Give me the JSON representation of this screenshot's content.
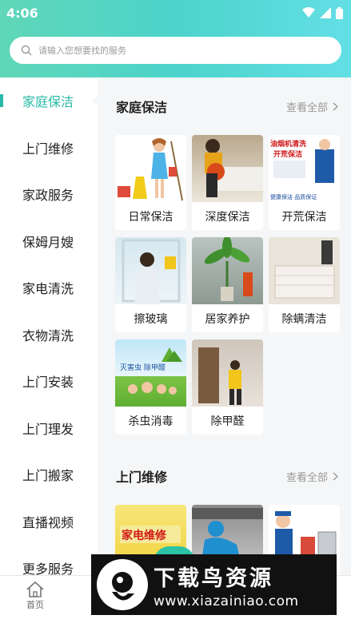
{
  "status_bar": {
    "time": "4:06"
  },
  "search": {
    "placeholder": "请输入您想要找的服务"
  },
  "sidebar": {
    "items": [
      {
        "label": "家庭保洁",
        "active": true
      },
      {
        "label": "上门维修"
      },
      {
        "label": "家政服务"
      },
      {
        "label": "保姆月嫂"
      },
      {
        "label": "家电清洗"
      },
      {
        "label": "衣物清洗"
      },
      {
        "label": "上门安装"
      },
      {
        "label": "上门理发"
      },
      {
        "label": "上门搬家"
      },
      {
        "label": "直播视频"
      },
      {
        "label": "更多服务"
      }
    ]
  },
  "sections": [
    {
      "title": "家庭保洁",
      "view_all": "查看全部",
      "items": [
        {
          "label": "日常保洁"
        },
        {
          "label": "深度保洁"
        },
        {
          "label": "开荒保洁",
          "photo_text": "油烟机清洗\n开荒保洁"
        },
        {
          "label": "擦玻璃"
        },
        {
          "label": "居家养护"
        },
        {
          "label": "除螨清洁"
        },
        {
          "label": "杀虫消毒",
          "photo_text": "灭害虫  除甲醛"
        },
        {
          "label": "除甲醛"
        }
      ]
    },
    {
      "title": "上门维修",
      "view_all": "查看全部",
      "items": [
        {
          "label": "",
          "photo_text": "家电维修"
        },
        {
          "label": ""
        },
        {
          "label": ""
        }
      ]
    }
  ],
  "tabbar": {
    "home_label": "首页"
  },
  "banner": {
    "title": "下载鸟资源",
    "url": "www.xiazainiao.com"
  },
  "colors": {
    "accent": "#28b9a8",
    "header_start": "#5fd7b8",
    "header_end": "#63dfe6"
  }
}
